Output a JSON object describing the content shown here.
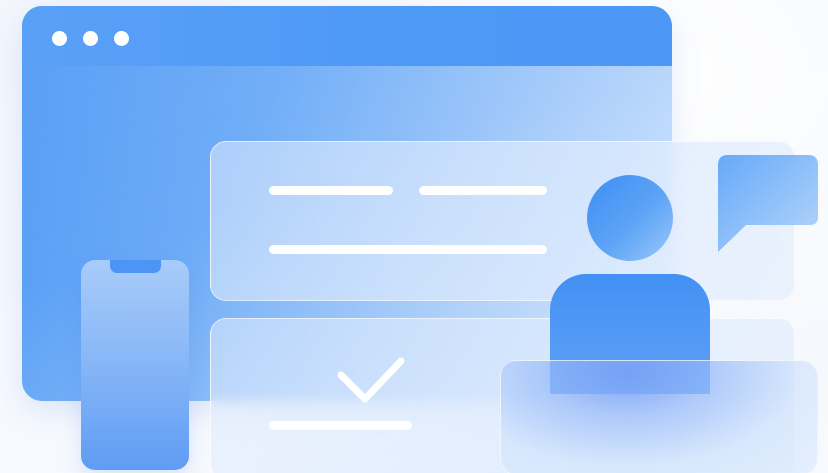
{
  "illustration": {
    "colors": {
      "primary_blue": "#4d98f6",
      "light_blue": "#a9cdfa",
      "glass": "#dceafd",
      "white": "#ffffff",
      "background": "#f6f8fd"
    },
    "icons": {
      "checkmark": "check-icon",
      "chat": "chat-bubble-icon",
      "person": "person-icon"
    },
    "browser_dots": 3
  }
}
